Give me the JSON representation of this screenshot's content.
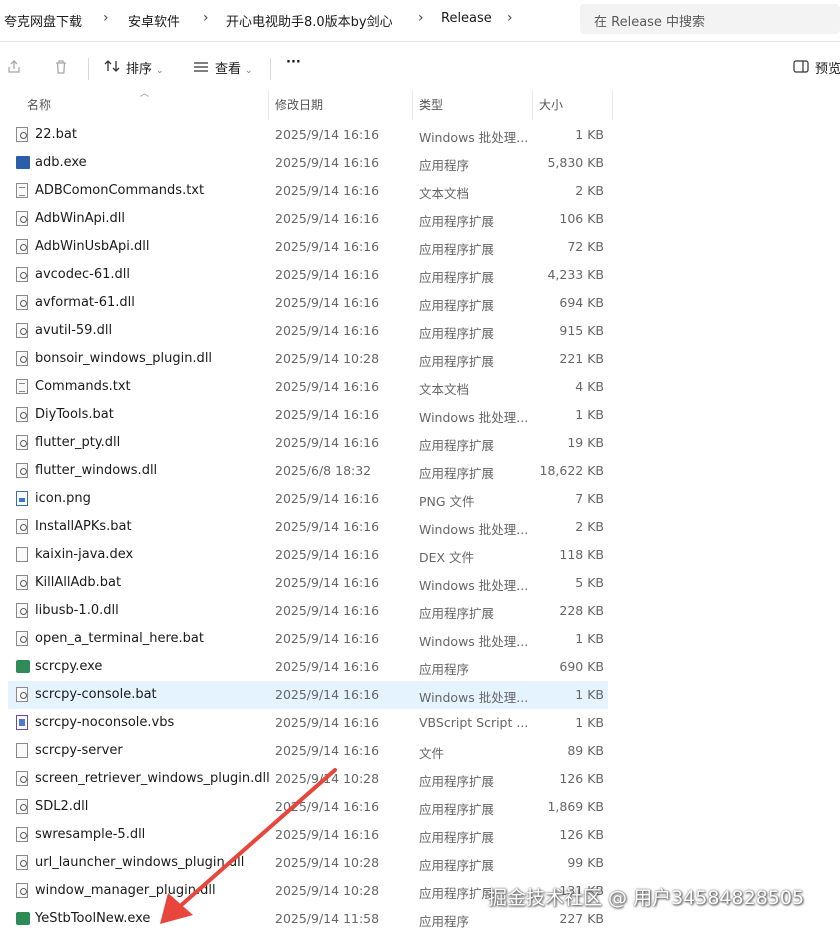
{
  "breadcrumb": [
    "夸克网盘下载",
    "安卓软件",
    "开心电视助手8.0版本by剑心",
    "Release"
  ],
  "search": {
    "placeholder": "在 Release 中搜索"
  },
  "toolbar": {
    "sort_label": "排序",
    "view_label": "查看",
    "more_label": "···",
    "preview_label": "预览"
  },
  "columns": {
    "name": "名称",
    "date": "修改日期",
    "type": "类型",
    "size": "大小"
  },
  "files": [
    {
      "name": "22.bat",
      "date": "2025/9/14 16:16",
      "type": "Windows 批处理...",
      "size": "1 KB",
      "icon": "batch-file-icon"
    },
    {
      "name": "adb.exe",
      "date": "2025/9/14 16:16",
      "type": "应用程序",
      "size": "5,830 KB",
      "icon": "exe-file-icon"
    },
    {
      "name": "ADBComonCommands.txt",
      "date": "2025/9/14 16:16",
      "type": "文本文档",
      "size": "2 KB",
      "icon": "text-file-icon"
    },
    {
      "name": "AdbWinApi.dll",
      "date": "2025/9/14 16:16",
      "type": "应用程序扩展",
      "size": "106 KB",
      "icon": "dll-file-icon"
    },
    {
      "name": "AdbWinUsbApi.dll",
      "date": "2025/9/14 16:16",
      "type": "应用程序扩展",
      "size": "72 KB",
      "icon": "dll-file-icon"
    },
    {
      "name": "avcodec-61.dll",
      "date": "2025/9/14 16:16",
      "type": "应用程序扩展",
      "size": "4,233 KB",
      "icon": "dll-file-icon"
    },
    {
      "name": "avformat-61.dll",
      "date": "2025/9/14 16:16",
      "type": "应用程序扩展",
      "size": "694 KB",
      "icon": "dll-file-icon"
    },
    {
      "name": "avutil-59.dll",
      "date": "2025/9/14 16:16",
      "type": "应用程序扩展",
      "size": "915 KB",
      "icon": "dll-file-icon"
    },
    {
      "name": "bonsoir_windows_plugin.dll",
      "date": "2025/9/14 10:28",
      "type": "应用程序扩展",
      "size": "221 KB",
      "icon": "dll-file-icon"
    },
    {
      "name": "Commands.txt",
      "date": "2025/9/14 16:16",
      "type": "文本文档",
      "size": "4 KB",
      "icon": "text-file-icon"
    },
    {
      "name": "DiyTools.bat",
      "date": "2025/9/14 16:16",
      "type": "Windows 批处理...",
      "size": "1 KB",
      "icon": "batch-file-icon"
    },
    {
      "name": "flutter_pty.dll",
      "date": "2025/9/14 16:16",
      "type": "应用程序扩展",
      "size": "19 KB",
      "icon": "dll-file-icon"
    },
    {
      "name": "flutter_windows.dll",
      "date": "2025/6/8 18:32",
      "type": "应用程序扩展",
      "size": "18,622 KB",
      "icon": "dll-file-icon"
    },
    {
      "name": "icon.png",
      "date": "2025/9/14 16:16",
      "type": "PNG 文件",
      "size": "7 KB",
      "icon": "image-file-icon"
    },
    {
      "name": "InstallAPKs.bat",
      "date": "2025/9/14 16:16",
      "type": "Windows 批处理...",
      "size": "2 KB",
      "icon": "batch-file-icon"
    },
    {
      "name": "kaixin-java.dex",
      "date": "2025/9/14 16:16",
      "type": "DEX 文件",
      "size": "118 KB",
      "icon": "blank-file-icon"
    },
    {
      "name": "KillAllAdb.bat",
      "date": "2025/9/14 16:16",
      "type": "Windows 批处理...",
      "size": "5 KB",
      "icon": "batch-file-icon"
    },
    {
      "name": "libusb-1.0.dll",
      "date": "2025/9/14 16:16",
      "type": "应用程序扩展",
      "size": "228 KB",
      "icon": "dll-file-icon"
    },
    {
      "name": "open_a_terminal_here.bat",
      "date": "2025/9/14 16:16",
      "type": "Windows 批处理...",
      "size": "1 KB",
      "icon": "batch-file-icon"
    },
    {
      "name": "scrcpy.exe",
      "date": "2025/9/14 16:16",
      "type": "应用程序",
      "size": "690 KB",
      "icon": "scrcpy-app-icon"
    },
    {
      "name": "scrcpy-console.bat",
      "date": "2025/9/14 16:16",
      "type": "Windows 批处理...",
      "size": "1 KB",
      "icon": "batch-file-icon"
    },
    {
      "name": "scrcpy-noconsole.vbs",
      "date": "2025/9/14 16:16",
      "type": "VBScript Script ...",
      "size": "1 KB",
      "icon": "vbscript-file-icon"
    },
    {
      "name": "scrcpy-server",
      "date": "2025/9/14 16:16",
      "type": "文件",
      "size": "89 KB",
      "icon": "blank-file-icon"
    },
    {
      "name": "screen_retriever_windows_plugin.dll",
      "date": "2025/9/14 10:28",
      "type": "应用程序扩展",
      "size": "126 KB",
      "icon": "dll-file-icon"
    },
    {
      "name": "SDL2.dll",
      "date": "2025/9/14 16:16",
      "type": "应用程序扩展",
      "size": "1,869 KB",
      "icon": "dll-file-icon"
    },
    {
      "name": "swresample-5.dll",
      "date": "2025/9/14 16:16",
      "type": "应用程序扩展",
      "size": "126 KB",
      "icon": "dll-file-icon"
    },
    {
      "name": "url_launcher_windows_plugin.dll",
      "date": "2025/9/14 10:28",
      "type": "应用程序扩展",
      "size": "99 KB",
      "icon": "dll-file-icon"
    },
    {
      "name": "window_manager_plugin.dll",
      "date": "2025/9/14 10:28",
      "type": "应用程序扩展",
      "size": "131 KB",
      "icon": "dll-file-icon"
    },
    {
      "name": "YeStbToolNew.exe",
      "date": "2025/9/14 11:58",
      "type": "应用程序",
      "size": "227 KB",
      "icon": "yestb-app-icon"
    }
  ],
  "selected_index": 20,
  "watermark": "掘金技术社区 @ 用户34584828505",
  "colors": {
    "selection": "#e5f3ff",
    "arrow": "#e8453c"
  }
}
